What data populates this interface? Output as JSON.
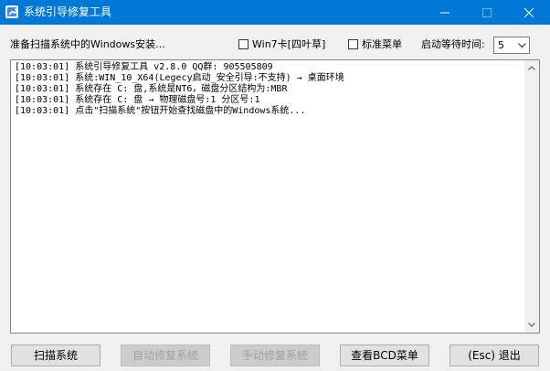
{
  "window": {
    "title": "系统引导修复工具",
    "controls": {
      "minimize": "minimize-icon",
      "maximize": "maximize-icon",
      "close": "close-icon"
    }
  },
  "toolbar": {
    "status": "准备扫描系统中的Windows安装...",
    "win7_card_label": "Win7卡[四叶草]",
    "win7_card_checked": false,
    "standard_menu_label": "标准菜单",
    "standard_menu_checked": false,
    "wait_time_label": "启动等待时间:",
    "wait_time_value": "5"
  },
  "log": {
    "lines": [
      "[10:03:01] 系统引导修复工具 v2.8.0           QQ群: 905505809",
      "[10:03:01] 系统:WIN_10_X64(Legecy启动_安全引导:不支持) → 桌面环境",
      "[10:03:01] 系统存在 C: 盘,系统是NT6，磁盘分区结构为:MBR",
      "[10:03:01] 系统存在 C: 盘 → 物理磁盘号:1 分区号:1",
      "[10:03:01] 点击\"扫描系统\"按钮开始查找磁盘中的Windows系统..."
    ]
  },
  "buttons": {
    "scan": "扫描系统",
    "auto_repair": "自动修复系统",
    "manual_repair": "手动修复系统",
    "view_bcd": "查看BCD菜单",
    "exit": "(Esc) 退出"
  },
  "colors": {
    "titlebar": "#0078d7",
    "background": "#f0f0f0",
    "disabled_text": "#a0a0a0"
  }
}
